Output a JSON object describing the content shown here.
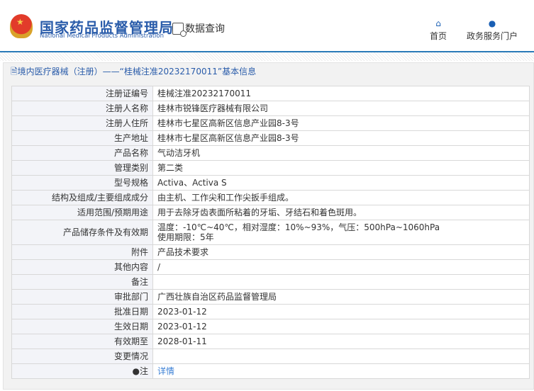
{
  "header": {
    "title_cn": "国家药品监督管理局",
    "title_en": "National Medical Products Administration",
    "data_query": "数据查询",
    "nav": [
      {
        "label": "首页",
        "icon": "home-icon"
      },
      {
        "label": "政务服务门户",
        "icon": "user-icon"
      }
    ]
  },
  "panel": {
    "title": "境内医疗器械（注册）——“桂械注准20232170011”基本信息"
  },
  "rows": [
    {
      "label": "注册证编号",
      "value": "桂械注准20232170011"
    },
    {
      "label": "注册人名称",
      "value": "桂林市锐锋医疗器械有限公司"
    },
    {
      "label": "注册人住所",
      "value": "桂林市七星区高新区信息产业园8-3号"
    },
    {
      "label": "生产地址",
      "value": "桂林市七星区高新区信息产业园8-3号"
    },
    {
      "label": "产品名称",
      "value": "气动洁牙机"
    },
    {
      "label": "管理类别",
      "value": "第二类"
    },
    {
      "label": "型号规格",
      "value": "Activa、Activa S"
    },
    {
      "label": "结构及组成/主要组成成分",
      "value": "由主机、工作尖和工作尖扳手组成。"
    },
    {
      "label": "适用范围/预期用途",
      "value": "用于去除牙齿表面所粘着的牙垢、牙结石和着色斑用。"
    },
    {
      "label": "产品储存条件及有效期",
      "value": "温度：-10℃~40℃，相对湿度：10%~93%，气压：500hPa~1060hPa",
      "value2": "使用期限：5年"
    },
    {
      "label": "附件",
      "value": "产品技术要求"
    },
    {
      "label": "其他内容",
      "value": "/"
    },
    {
      "label": "备注",
      "value": ""
    },
    {
      "label": "审批部门",
      "value": "广西壮族自治区药品监督管理局"
    },
    {
      "label": "批准日期",
      "value": "2023-01-12"
    },
    {
      "label": "生效日期",
      "value": "2023-01-12"
    },
    {
      "label": "有效期至",
      "value": "2028-01-11"
    },
    {
      "label": "变更情况",
      "value": ""
    },
    {
      "label": "注",
      "value": "详情"
    }
  ]
}
